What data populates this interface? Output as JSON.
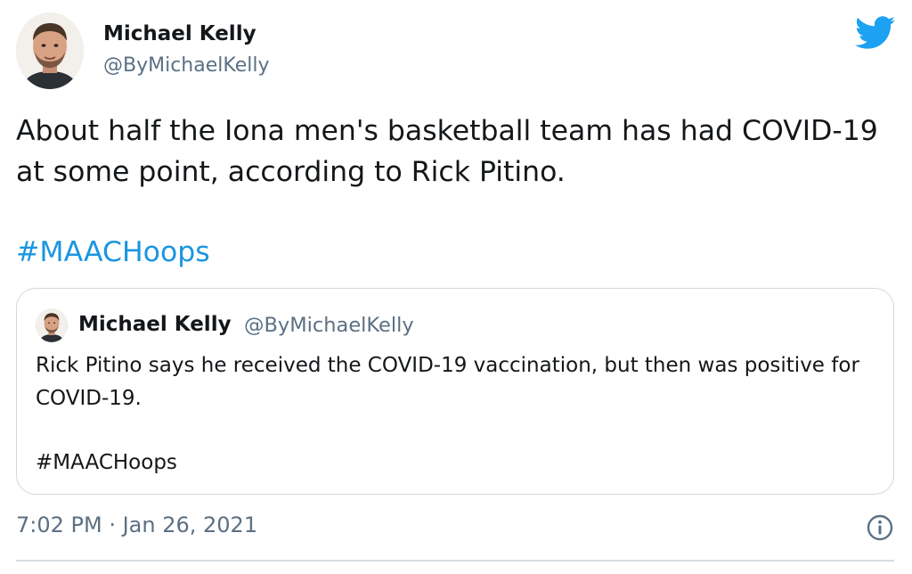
{
  "author": {
    "display_name": "Michael Kelly",
    "handle": "@ByMichaelKelly",
    "avatar_icon": "profile-photo"
  },
  "brand": {
    "logo_icon": "twitter-bird-icon",
    "color": "#1da1f2"
  },
  "tweet": {
    "text": "About half the Iona men's basketball team has had COVID-19 at some point, according to Rick Pitino.",
    "hashtag": "#MAACHoops",
    "hashtag_color": "#1b95e0"
  },
  "quoted_tweet": {
    "display_name": "Michael Kelly",
    "handle": "@ByMichaelKelly",
    "text": "Rick Pitino says he received the COVID-19 vaccination, but then was positive for COVID-19.",
    "hashtag": "#MAACHoops"
  },
  "footer": {
    "timestamp": "7:02 PM · Jan 26, 2021",
    "info_icon": "info-icon"
  }
}
